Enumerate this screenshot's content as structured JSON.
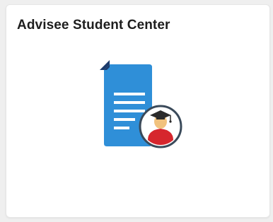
{
  "tile": {
    "title": "Advisee Student Center",
    "icon": "document-with-graduate-icon"
  },
  "colors": {
    "document_blue": "#2f8fd8",
    "document_fold_dark": "#1c3b6b",
    "document_lines": "#ffffff",
    "badge_border": "#3a4a5a",
    "badge_fill": "#ffffff",
    "graduate_gown": "#d6262d",
    "graduate_face": "#f1c27d",
    "mortarboard": "#2b2b2b"
  }
}
